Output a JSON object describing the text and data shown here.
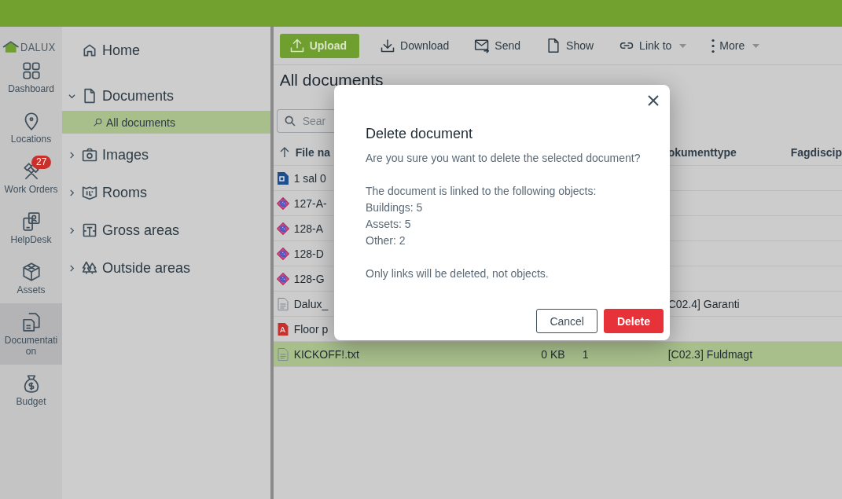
{
  "rail": {
    "logo": "DALUX",
    "items": [
      {
        "label": "Dashboard",
        "selected": false
      },
      {
        "label": "Locations",
        "selected": false
      },
      {
        "label": "Work Orders",
        "selected": false,
        "badge": "27"
      },
      {
        "label": "HelpDesk",
        "selected": false
      },
      {
        "label": "Assets",
        "selected": false
      },
      {
        "label": "Documentati on",
        "selected": true
      },
      {
        "label": "Budget",
        "selected": false
      }
    ]
  },
  "tree": [
    {
      "label": "Home",
      "selected": false
    },
    {
      "label": "Documents",
      "selected": false,
      "expanded": true,
      "children": [
        {
          "label": "All documents",
          "selected": true
        }
      ]
    },
    {
      "label": "Images",
      "selected": false,
      "expanded": false
    },
    {
      "label": "Rooms",
      "selected": false,
      "expanded": false
    },
    {
      "label": "Gross areas",
      "selected": false,
      "expanded": false
    },
    {
      "label": "Outside areas",
      "selected": false,
      "expanded": false
    }
  ],
  "toolbar": [
    {
      "label": "Upload",
      "primary": true,
      "dropdown": false
    },
    {
      "label": "Download",
      "primary": false,
      "dropdown": false
    },
    {
      "label": "Send",
      "primary": false,
      "dropdown": false
    },
    {
      "label": "Show",
      "primary": false,
      "dropdown": false
    },
    {
      "label": "Link to",
      "primary": false,
      "dropdown": true
    },
    {
      "label": "More",
      "primary": false,
      "dropdown": true
    }
  ],
  "page_title": "All documents",
  "search": {
    "placeholder": "Sear"
  },
  "table": {
    "columns": [
      "File na",
      "okumenttype",
      "Fagdiscip"
    ],
    "rows": [
      {
        "kind": "drawing",
        "name": "1 sal 0",
        "selected": false
      },
      {
        "kind": "model",
        "name": "127-A-",
        "selected": false
      },
      {
        "kind": "model",
        "name": "128-A",
        "selected": false
      },
      {
        "kind": "model",
        "name": "128-D",
        "selected": false
      },
      {
        "kind": "model",
        "name": "128-G",
        "selected": false
      },
      {
        "kind": "text",
        "name": "Dalux_",
        "type": "C02.4] Garanti",
        "selected": false
      },
      {
        "kind": "pdf",
        "name": "Floor p",
        "selected": false
      },
      {
        "kind": "text",
        "name": "KICKOFF!.txt",
        "size": "0 KB",
        "version": "1",
        "type": "[C02.3] Fuldmagt",
        "selected": true
      }
    ]
  },
  "dialog": {
    "title": "Delete document",
    "paragraphs": [
      [
        "Are you sure you want to delete the selected document?"
      ],
      [
        "The document is linked to the following objects:",
        "Buildings: 5",
        "Assets: 5",
        "Other: 2"
      ],
      [
        "Only links will be deleted, not objects."
      ]
    ],
    "buttons": [
      {
        "kind": "secondary",
        "label": "Cancel"
      },
      {
        "kind": "danger",
        "label": "Delete"
      }
    ]
  }
}
